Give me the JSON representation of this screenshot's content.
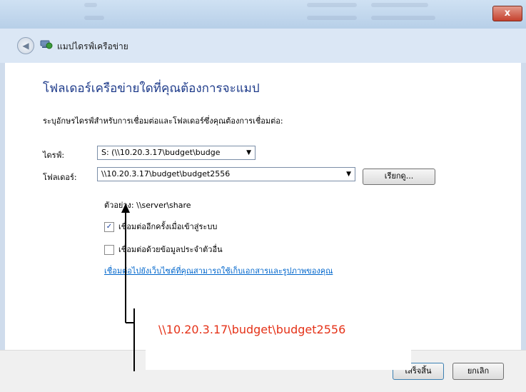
{
  "window": {
    "close_label": "x"
  },
  "nav": {
    "back_label": "◀",
    "title": "แมปไดรฟ์เครือข่าย"
  },
  "dialog": {
    "heading": "โฟลเดอร์เครือข่ายใดที่คุณต้องการจะแมป",
    "instruction": "ระบุอักษรไดรฟ์สำหรับการเชื่อมต่อและโฟลเดอร์ซึ่งคุณต้องการเชื่อมต่อ:",
    "drive_label": "ไดรฟ์:",
    "drive_value": "S: (\\\\10.20.3.17\\budget\\budge",
    "folder_label": "โฟลเดอร์:",
    "folder_value": "\\\\10.20.3.17\\budget\\budget2556",
    "browse_label": "เรียกดู...",
    "example": "ตัวอย่าง: \\\\server\\share",
    "reconnect_label": "เชื่อมต่ออีกครั้งเมื่อเข้าสู่ระบบ",
    "reconnect_checked": true,
    "credentials_label": "เชื่อมต่อด้วยข้อมูลประจำตัวอื่น",
    "credentials_checked": false,
    "link": "เชื่อมต่อไปยังเว็บไซต์ที่คุณสามารถใช้เก็บเอกสารและรูปภาพของคุณ",
    "finish_label": "เสร็จสิ้น",
    "cancel_label": "ยกเลิก"
  },
  "annotation": {
    "text": "\\\\10.20.3.17\\budget\\budget2556",
    "color": "#e53218"
  },
  "icons": {
    "back": "back-arrow-icon",
    "network": "network-drive-icon",
    "dropdown": "chevron-down-icon",
    "check": "checkmark-icon"
  }
}
